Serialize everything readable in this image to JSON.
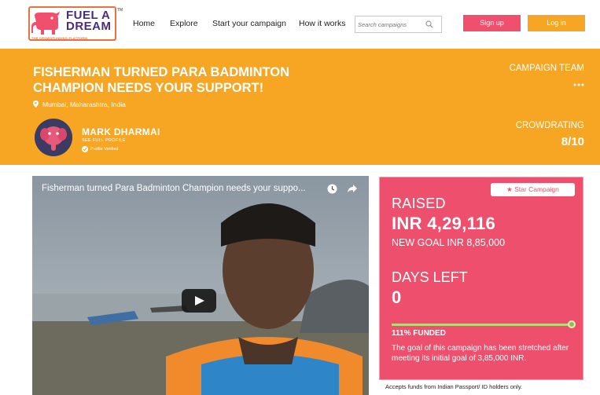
{
  "brand": {
    "line1": "FUEL A",
    "line2": "DREAM",
    "tagline": "THE CROWDFUNDING PLATFORM",
    "trademark": "TM"
  },
  "nav": {
    "home": "Home",
    "explore": "Explore",
    "start": "Start your campaign",
    "how": "How it works"
  },
  "search": {
    "placeholder": "Search campaigns"
  },
  "auth": {
    "signup": "Sign up",
    "login": "Log in"
  },
  "campaign": {
    "title": "FISHERMAN TURNED PARA BADMINTON CHAMPION NEEDS YOUR SUPPORT!",
    "location": "Mumbai, Maharashtra, India",
    "owner": {
      "name": "MARK DHARMAI",
      "profile_link": "SEE FULL PROFILE",
      "verified": "Profile Verified"
    },
    "team_label": "CAMPAIGN TEAM",
    "crowdrating_label": "CROWDRATING",
    "crowdrating_value": "8/10"
  },
  "video": {
    "title": "Fisherman turned Para Badminton Champion needs your suppo..."
  },
  "funding": {
    "badge": "Star Campaign",
    "raised_label": "RAISED",
    "raised_value": "INR 4,29,116",
    "new_goal": "NEW GOAL INR 8,85,000",
    "days_label": "DAYS LEFT",
    "days_value": "0",
    "funded_pct": 111,
    "funded_text": "111% FUNDED",
    "stretch_note": "The goal of this campaign has been stretched after meeting its initial goal of 3,85,000 INR."
  },
  "footer_note": "Accepts funds from Indian Passport/ ID holders only.",
  "colors": {
    "accent_orange": "#f6a623",
    "accent_pink": "#ee4f6c",
    "brand_purple": "#4a2d7a"
  }
}
